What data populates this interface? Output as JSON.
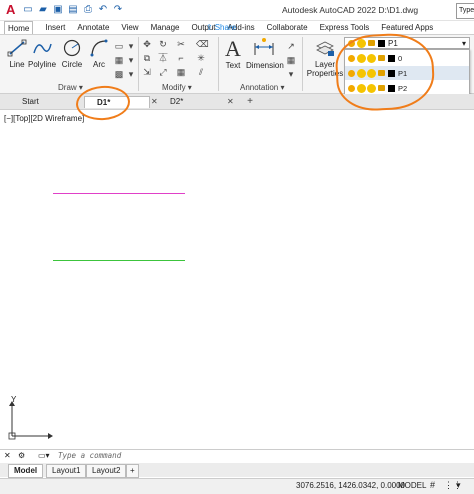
{
  "title_bar": {
    "logo": "A",
    "title": "Autodesk AutoCAD 2022    D:\\D1.dwg",
    "search_placeholder": "Type"
  },
  "ribbon_tabs": [
    "Home",
    "Insert",
    "Annotate",
    "View",
    "Manage",
    "Output",
    "Add-ins",
    "Collaborate",
    "Express Tools",
    "Featured Apps"
  ],
  "share_label": "Share",
  "ribbon": {
    "draw_tools": [
      {
        "label": "Line",
        "icon": "line-icon"
      },
      {
        "label": "Polyline",
        "icon": "polyline-icon"
      },
      {
        "label": "Circle",
        "icon": "circle-icon"
      },
      {
        "label": "Arc",
        "icon": "arc-icon"
      }
    ],
    "draw_label": "Draw",
    "modify_label": "Modify",
    "annotation_tools": [
      {
        "label": "Text",
        "icon": "text-icon"
      },
      {
        "label": "Dimension",
        "icon": "dimension-icon"
      }
    ],
    "annotation_label": "Annotation",
    "layer_properties_label": "Layer\nProperties",
    "panel_dropdown_glyph": "▾"
  },
  "layers": {
    "current": "P1",
    "list": [
      {
        "name": "0",
        "selected": false
      },
      {
        "name": "P1",
        "selected": true
      },
      {
        "name": "P2",
        "selected": false
      }
    ]
  },
  "doc_tabs": [
    {
      "label": "Start",
      "active": false
    },
    {
      "label": "D1*",
      "active": true
    },
    {
      "label": "D2*",
      "active": false
    }
  ],
  "close_glyph": "✕",
  "plus_glyph": "+",
  "viewport_label": "[−][Top][2D Wireframe]",
  "drawing_lines": [
    {
      "color": "#e040c8"
    },
    {
      "color": "#3cc43c"
    }
  ],
  "ucs": {
    "y_label": "Y"
  },
  "command_placeholder": "Type a command",
  "layout_tabs": [
    {
      "label": "Model",
      "active": true
    },
    {
      "label": "Layout1",
      "active": false
    },
    {
      "label": "Layout2",
      "active": false
    }
  ],
  "status": {
    "coords": "3076.2516, 1426.0342, 0.0000",
    "space": "MODEL"
  },
  "colors": {
    "annotation_orange": "#f07d1a",
    "accent_blue": "#1c5fa8",
    "autocad_red": "#c8102e"
  }
}
